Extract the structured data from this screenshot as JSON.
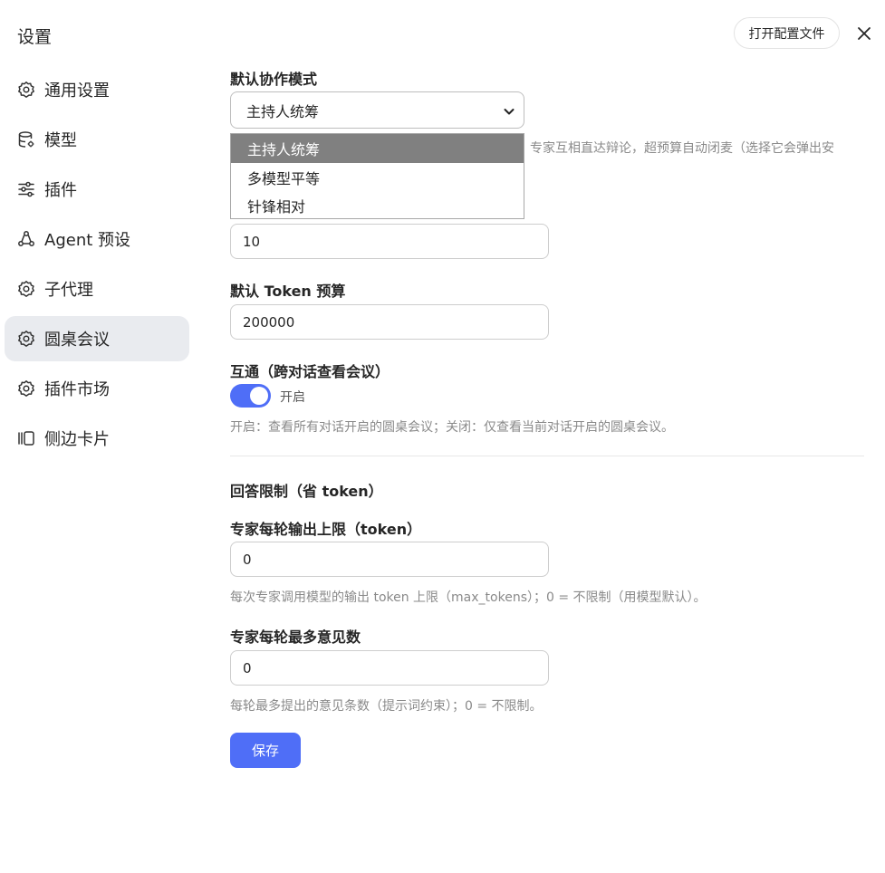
{
  "header": {
    "title": "设置",
    "open_config_label": "打开配置文件",
    "close_icon": "close-icon"
  },
  "sidebar": {
    "items": [
      {
        "label": "通用设置",
        "icon": "gear-icon",
        "active": false
      },
      {
        "label": "模型",
        "icon": "database-icon",
        "active": false
      },
      {
        "label": "插件",
        "icon": "sliders-icon",
        "active": false
      },
      {
        "label": "Agent 预设",
        "icon": "agent-icon",
        "active": false
      },
      {
        "label": "子代理",
        "icon": "gear-icon",
        "active": false
      },
      {
        "label": "圆桌会议",
        "icon": "gear-icon",
        "active": true
      },
      {
        "label": "插件市场",
        "icon": "gear-icon",
        "active": false
      },
      {
        "label": "侧边卡片",
        "icon": "side-card-icon",
        "active": false
      }
    ]
  },
  "main": {
    "mode": {
      "label": "默认协作模式",
      "selected": "主持人统筹",
      "options": [
        "主持人统筹",
        "多模型平等",
        "针锋相对"
      ],
      "desc_partial": "专家互相直达辩论，超预算自动闭麦（选择它会弹出安"
    },
    "rounds": {
      "value": "10"
    },
    "token_budget": {
      "label": "默认 Token 预算",
      "value": "200000"
    },
    "interop": {
      "label": "互通（跨对话查看会议）",
      "toggle_label": "开启",
      "enabled": true,
      "hint": "开启：查看所有对话开启的圆桌会议；关闭：仅查看当前对话开启的圆桌会议。"
    },
    "limits": {
      "section_title": "回答限制（省 token）",
      "max_output": {
        "label": "专家每轮输出上限（token）",
        "value": "0",
        "hint": "每次专家调用模型的输出 token 上限（max_tokens）；0 = 不限制（用模型默认）。"
      },
      "max_opinions": {
        "label": "专家每轮最多意见数",
        "value": "0",
        "hint": "每轮最多提出的意见条数（提示词约束）；0 = 不限制。"
      }
    },
    "save_label": "保存"
  },
  "colors": {
    "accent": "#4f6ef7",
    "active_nav_bg": "#e9ebef",
    "dropdown_selected_bg": "#808080"
  }
}
